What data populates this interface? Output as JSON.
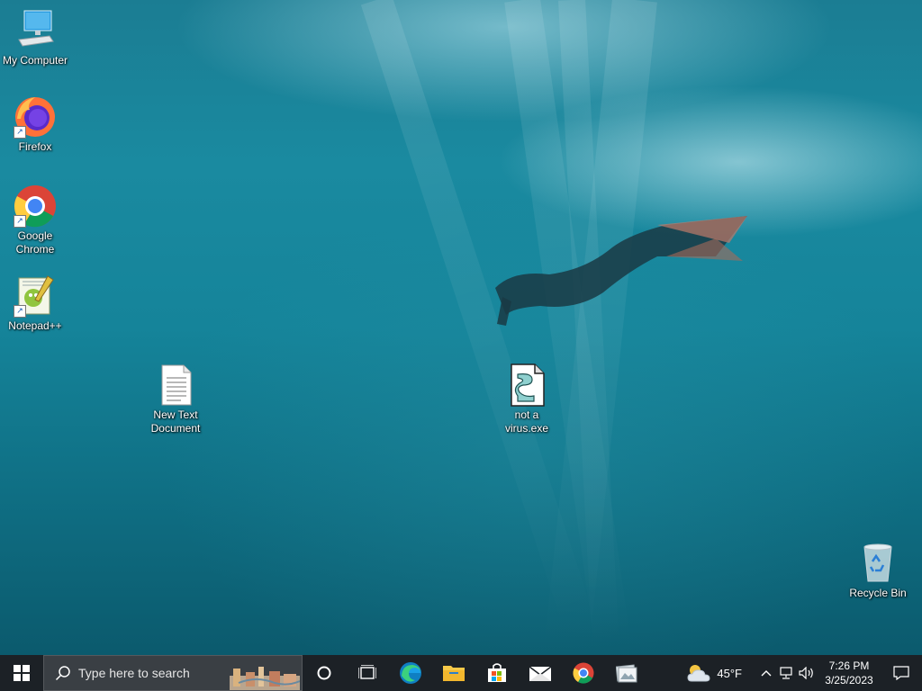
{
  "desktop": {
    "icons": [
      {
        "label_lines": [
          "My Computer"
        ],
        "icon": "computer-icon"
      },
      {
        "label_lines": [
          "Firefox"
        ],
        "icon": "firefox-icon"
      },
      {
        "label_lines": [
          "Google",
          "Chrome"
        ],
        "icon": "chrome-icon"
      },
      {
        "label_lines": [
          "Notepad++"
        ],
        "icon": "notepadpp-icon"
      },
      {
        "label_lines": [
          "New Text",
          "Document"
        ],
        "icon": "text-file-icon"
      },
      {
        "label_lines": [
          "not a",
          "virus.exe"
        ],
        "icon": "script-file-icon"
      },
      {
        "label_lines": [
          "Recycle Bin"
        ],
        "icon": "recycle-bin-icon"
      }
    ]
  },
  "taskbar": {
    "search_placeholder": "Type here to search",
    "pinned": [
      "cortana-icon",
      "task-view-icon",
      "edge-icon",
      "file-explorer-icon",
      "microsoft-store-icon",
      "mail-icon",
      "chrome-icon",
      "photos-icon"
    ],
    "weather": {
      "temp": "45°F",
      "icon": "partly-cloudy-icon"
    },
    "clock": {
      "time": "7:26 PM",
      "date": "3/25/2023"
    }
  },
  "colors": {
    "taskbar": "#1c2126",
    "search_box": "#3a3f44",
    "accent_blue": "#1a73e8"
  }
}
